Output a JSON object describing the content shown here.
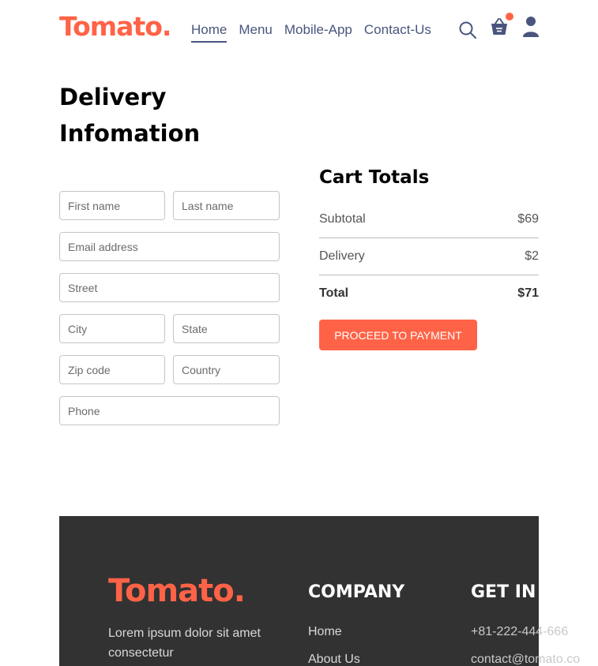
{
  "brand": {
    "name": "Tomato.",
    "accent": "#ff6347"
  },
  "nav": {
    "items": [
      {
        "label": "Home",
        "active": true
      },
      {
        "label": "Menu",
        "active": false
      },
      {
        "label": "Mobile-App",
        "active": false
      },
      {
        "label": "Contact-Us",
        "active": false
      }
    ],
    "icons": [
      "search-icon",
      "basket-icon",
      "user-icon"
    ]
  },
  "delivery": {
    "title": "Delivery Infomation",
    "fields": {
      "first_name": "First name",
      "last_name": "Last name",
      "email": "Email address",
      "street": "Street",
      "city": "City",
      "state": "State",
      "zip": "Zip code",
      "country": "Country",
      "phone": "Phone"
    }
  },
  "cart": {
    "title": "Cart Totals",
    "subtotal_label": "Subtotal",
    "subtotal_value": "$69",
    "delivery_label": "Delivery",
    "delivery_value": "$2",
    "total_label": "Total",
    "total_value": "$71",
    "button_label": "PROCEED TO PAYMENT"
  },
  "footer": {
    "logo": "Tomato.",
    "description": "Lorem ipsum dolor sit amet consectetur",
    "company_heading": "COMPANY",
    "company_links": [
      "Home",
      "About Us"
    ],
    "contact_heading": "GET IN TOUCH",
    "phone": "+81-222-444-666",
    "email": "contact@tomato.co"
  }
}
